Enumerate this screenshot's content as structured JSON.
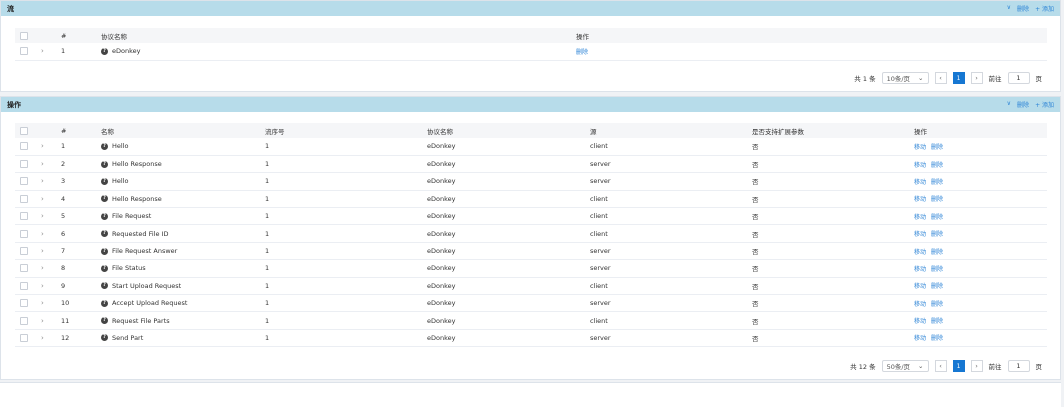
{
  "flow_panel": {
    "title": "流",
    "actions": {
      "expand": "∨",
      "delete": "删除",
      "add": "+ 添加"
    },
    "columns": [
      "#",
      "协议名称",
      "操作"
    ],
    "rows": [
      {
        "index": "1",
        "name": "eDonkey",
        "op": "删除"
      }
    ],
    "pager": {
      "total": "共 1 条",
      "page_size": "10条/页",
      "page": "1",
      "goto": "前往",
      "goto_value": "1",
      "unit": "页"
    }
  },
  "ops_panel": {
    "title": "操作",
    "actions": {
      "expand": "∨",
      "delete": "删除",
      "add": "+ 添加"
    },
    "columns": [
      "#",
      "名称",
      "流序号",
      "协议名称",
      "源",
      "是否支持扩展参数",
      "操作"
    ],
    "rows": [
      {
        "index": "1",
        "name": "Hello",
        "flow": "1",
        "protocol": "eDonkey",
        "source": "client",
        "ext": "否"
      },
      {
        "index": "2",
        "name": "Hello Response",
        "flow": "1",
        "protocol": "eDonkey",
        "source": "server",
        "ext": "否"
      },
      {
        "index": "3",
        "name": "Hello",
        "flow": "1",
        "protocol": "eDonkey",
        "source": "server",
        "ext": "否"
      },
      {
        "index": "4",
        "name": "Hello Response",
        "flow": "1",
        "protocol": "eDonkey",
        "source": "client",
        "ext": "否"
      },
      {
        "index": "5",
        "name": "File Request",
        "flow": "1",
        "protocol": "eDonkey",
        "source": "client",
        "ext": "否"
      },
      {
        "index": "6",
        "name": "Requested File ID",
        "flow": "1",
        "protocol": "eDonkey",
        "source": "client",
        "ext": "否"
      },
      {
        "index": "7",
        "name": "File Request Answer",
        "flow": "1",
        "protocol": "eDonkey",
        "source": "server",
        "ext": "否"
      },
      {
        "index": "8",
        "name": "File Status",
        "flow": "1",
        "protocol": "eDonkey",
        "source": "server",
        "ext": "否"
      },
      {
        "index": "9",
        "name": "Start Upload Request",
        "flow": "1",
        "protocol": "eDonkey",
        "source": "client",
        "ext": "否"
      },
      {
        "index": "10",
        "name": "Accept Upload Request",
        "flow": "1",
        "protocol": "eDonkey",
        "source": "server",
        "ext": "否"
      },
      {
        "index": "11",
        "name": "Request File Parts",
        "flow": "1",
        "protocol": "eDonkey",
        "source": "client",
        "ext": "否"
      },
      {
        "index": "12",
        "name": "Send Part",
        "flow": "1",
        "protocol": "eDonkey",
        "source": "server",
        "ext": "否"
      }
    ],
    "row_ops": {
      "move": "移动",
      "delete": "删除"
    },
    "pager": {
      "total": "共 12 条",
      "page_size": "50条/页",
      "page": "1",
      "goto": "前往",
      "goto_value": "1",
      "unit": "页"
    }
  },
  "icons": {
    "row_expand": "chevron-right-icon",
    "info": "question-circle-icon",
    "prev": "chevron-left-icon",
    "next": "chevron-right-icon"
  },
  "colors": {
    "header_bg": "#b7dcea",
    "link": "#2b83d6",
    "active_page": "#1677d2"
  }
}
